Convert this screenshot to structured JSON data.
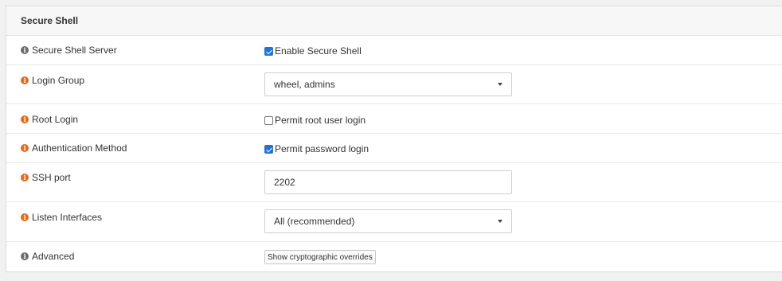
{
  "panel": {
    "title": "Secure Shell"
  },
  "rows": {
    "server": {
      "label": "Secure Shell Server",
      "icon": "info-icon",
      "checkbox_label": "Enable Secure Shell",
      "checked": true
    },
    "login_group": {
      "label": "Login Group",
      "icon": "info-icon",
      "selected": "wheel, admins"
    },
    "root_login": {
      "label": "Root Login",
      "icon": "info-icon",
      "checkbox_label": "Permit root user login",
      "checked": false
    },
    "auth_method": {
      "label": "Authentication Method",
      "icon": "info-icon",
      "checkbox_label": "Permit password login",
      "checked": true
    },
    "ssh_port": {
      "label": "SSH port",
      "icon": "info-icon",
      "value": "2202"
    },
    "listen_interfaces": {
      "label": "Listen Interfaces",
      "icon": "info-icon",
      "selected": "All (recommended)"
    },
    "advanced": {
      "label": "Advanced",
      "icon": "info-icon",
      "button_label": "Show cryptographic overrides"
    }
  },
  "colors": {
    "info_icon_grey": "#6d6d6d",
    "info_icon_orange": "#e36b1e",
    "checkbox_checked": "#1e73d8"
  }
}
